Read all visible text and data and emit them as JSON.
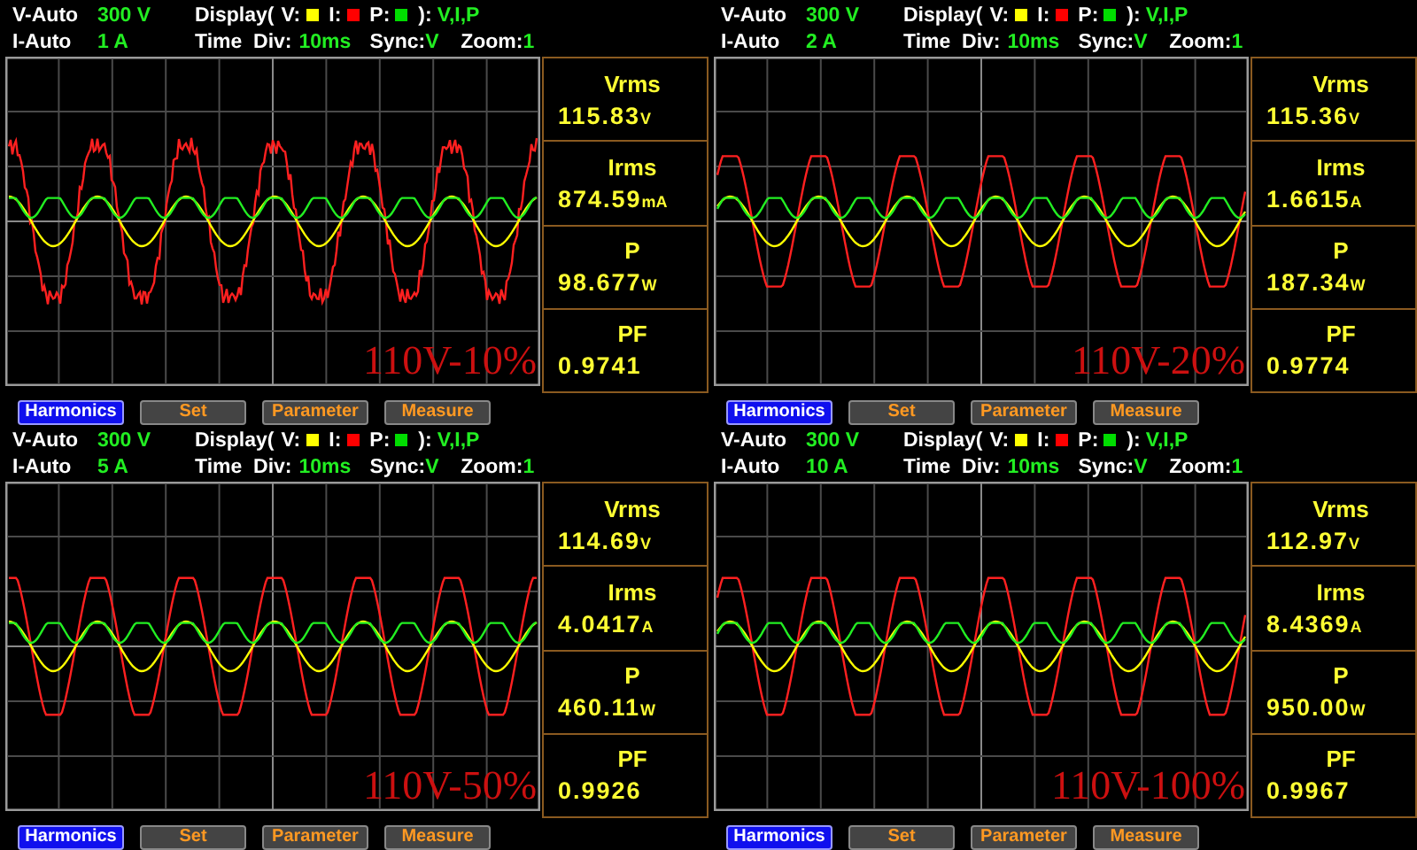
{
  "panels": [
    {
      "header": {
        "v_mode": "V-Auto",
        "v_range": "300 V",
        "display_label": "Display(",
        "legend": [
          {
            "label": "V:",
            "color": "#ffff00"
          },
          {
            "label": "I:",
            "color": "#ff0000"
          },
          {
            "label": "P:",
            "color": "#00dd00"
          }
        ],
        "display_close": "):",
        "display_value": "V,I,P",
        "i_mode": "I-Auto",
        "i_range": "1 A",
        "time_div_label": "Time  Div:",
        "time_div": "10ms",
        "sync_label": "Sync:",
        "sync": "V",
        "zoom_label": "Zoom:",
        "zoom": "1"
      },
      "overlay": "110V-10%",
      "readings": [
        {
          "label": "Vrms",
          "value": "115.83",
          "unit": "V"
        },
        {
          "label": "Irms",
          "value": "874.59",
          "unit": "mA"
        },
        {
          "label": "P",
          "value": "98.677",
          "unit": "W"
        },
        {
          "label": "PF",
          "value": "0.9741"
        }
      ],
      "buttons": [
        {
          "label": "Harmonics",
          "selected": true
        },
        {
          "label": "Set",
          "selected": false
        },
        {
          "label": "Parameter",
          "selected": false
        },
        {
          "label": "Measure",
          "selected": false
        }
      ]
    },
    {
      "header": {
        "v_mode": "V-Auto",
        "v_range": "300 V",
        "display_label": "Display(",
        "legend": [
          {
            "label": "V:",
            "color": "#ffff00"
          },
          {
            "label": "I:",
            "color": "#ff0000"
          },
          {
            "label": "P:",
            "color": "#00dd00"
          }
        ],
        "display_close": "):",
        "display_value": "V,I,P",
        "i_mode": "I-Auto",
        "i_range": "2 A",
        "time_div_label": "Time  Div:",
        "time_div": "10ms",
        "sync_label": "Sync:",
        "sync": "V",
        "zoom_label": "Zoom:",
        "zoom": "1"
      },
      "overlay": "110V-20%",
      "readings": [
        {
          "label": "Vrms",
          "value": "115.36",
          "unit": "V"
        },
        {
          "label": "Irms",
          "value": "1.6615",
          "unit": "A"
        },
        {
          "label": "P",
          "value": "187.34",
          "unit": "W"
        },
        {
          "label": "PF",
          "value": "0.9774"
        }
      ],
      "buttons": [
        {
          "label": "Harmonics",
          "selected": true
        },
        {
          "label": "Set",
          "selected": false
        },
        {
          "label": "Parameter",
          "selected": false
        },
        {
          "label": "Measure",
          "selected": false
        }
      ]
    },
    {
      "header": {
        "v_mode": "V-Auto",
        "v_range": "300 V",
        "display_label": "Display(",
        "legend": [
          {
            "label": "V:",
            "color": "#ffff00"
          },
          {
            "label": "I:",
            "color": "#ff0000"
          },
          {
            "label": "P:",
            "color": "#00dd00"
          }
        ],
        "display_close": "):",
        "display_value": "V,I,P",
        "i_mode": "I-Auto",
        "i_range": "5 A",
        "time_div_label": "Time  Div:",
        "time_div": "10ms",
        "sync_label": "Sync:",
        "sync": "V",
        "zoom_label": "Zoom:",
        "zoom": "1"
      },
      "overlay": "110V-50%",
      "readings": [
        {
          "label": "Vrms",
          "value": "114.69",
          "unit": "V"
        },
        {
          "label": "Irms",
          "value": "4.0417",
          "unit": "A"
        },
        {
          "label": "P",
          "value": "460.11",
          "unit": "W"
        },
        {
          "label": "PF",
          "value": "0.9926"
        }
      ],
      "buttons": [
        {
          "label": "Harmonics",
          "selected": true
        },
        {
          "label": "Set",
          "selected": false
        },
        {
          "label": "Parameter",
          "selected": false
        },
        {
          "label": "Measure",
          "selected": false
        }
      ]
    },
    {
      "header": {
        "v_mode": "V-Auto",
        "v_range": "300 V",
        "display_label": "Display(",
        "legend": [
          {
            "label": "V:",
            "color": "#ffff00"
          },
          {
            "label": "I:",
            "color": "#ff0000"
          },
          {
            "label": "P:",
            "color": "#00dd00"
          }
        ],
        "display_close": "):",
        "display_value": "V,I,P",
        "i_mode": "I-Auto",
        "i_range": "10 A",
        "time_div_label": "Time  Div:",
        "time_div": "10ms",
        "sync_label": "Sync:",
        "sync": "V",
        "zoom_label": "Zoom:",
        "zoom": "1"
      },
      "overlay": "110V-100%",
      "readings": [
        {
          "label": "Vrms",
          "value": "112.97",
          "unit": "V"
        },
        {
          "label": "Irms",
          "value": "8.4369",
          "unit": "A"
        },
        {
          "label": "P",
          "value": "950.00",
          "unit": "W"
        },
        {
          "label": "PF",
          "value": "0.9967"
        }
      ],
      "buttons": [
        {
          "label": "Harmonics",
          "selected": true
        },
        {
          "label": "Set",
          "selected": false
        },
        {
          "label": "Parameter",
          "selected": false
        },
        {
          "label": "Measure",
          "selected": false
        }
      ]
    }
  ]
}
